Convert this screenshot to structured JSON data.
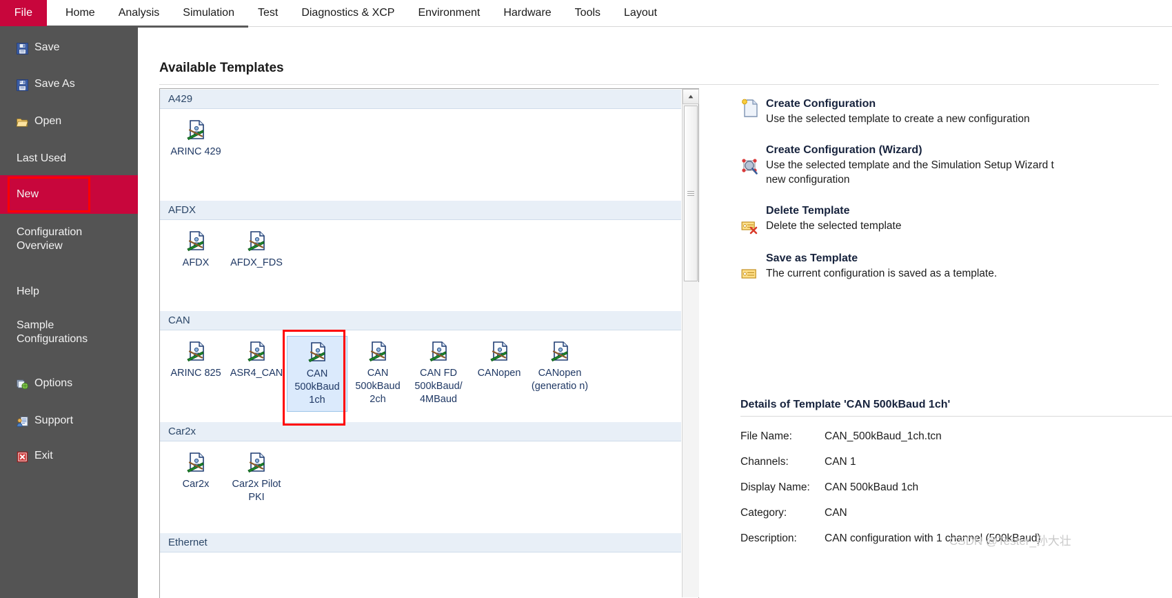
{
  "ribbon": {
    "file_label": "File",
    "tabs": [
      {
        "label": "Home"
      },
      {
        "label": "Analysis"
      },
      {
        "label": "Simulation"
      },
      {
        "label": "Test"
      },
      {
        "label": "Diagnostics & XCP"
      },
      {
        "label": "Environment"
      },
      {
        "label": "Hardware"
      },
      {
        "label": "Tools"
      },
      {
        "label": "Layout"
      }
    ]
  },
  "colors": {
    "accent": "#c8063c",
    "sidebar_bg": "#545454",
    "selection_outline": "#ff0000",
    "tile_selected_bg": "#dbeafc",
    "group_header_bg": "#e8eff7"
  },
  "sidebar": {
    "items": [
      {
        "label": "Save",
        "icon": "save-icon",
        "selected": false
      },
      {
        "label": "Save As",
        "icon": "save-as-icon",
        "selected": false
      },
      {
        "label": "Open",
        "icon": "open-folder-icon",
        "selected": false
      },
      {
        "label": "Last Used",
        "icon": "",
        "selected": false
      },
      {
        "label": "New",
        "icon": "",
        "selected": true
      },
      {
        "label": "Configuration\nOverview",
        "icon": "",
        "selected": false
      },
      {
        "label": "Help",
        "icon": "",
        "selected": false
      },
      {
        "label": "Sample\nConfigurations",
        "icon": "",
        "selected": false
      },
      {
        "label": "Options",
        "icon": "options-icon",
        "selected": false
      },
      {
        "label": "Support",
        "icon": "support-icon",
        "selected": false
      },
      {
        "label": "Exit",
        "icon": "exit-icon",
        "selected": false
      }
    ]
  },
  "templates": {
    "heading": "Available Templates",
    "groups": [
      {
        "name": "A429",
        "items": [
          {
            "label": "ARINC\n429",
            "selected": false
          }
        ]
      },
      {
        "name": "AFDX",
        "items": [
          {
            "label": "AFDX",
            "selected": false
          },
          {
            "label": "AFDX_FDS",
            "selected": false
          }
        ]
      },
      {
        "name": "CAN",
        "items": [
          {
            "label": "ARINC\n825",
            "selected": false
          },
          {
            "label": "ASR4_CAN",
            "selected": false
          },
          {
            "label": "CAN\n500kBaud\n1ch",
            "selected": true
          },
          {
            "label": "CAN\n500kBaud\n2ch",
            "selected": false
          },
          {
            "label": "CAN FD\n500kBaud/\n4MBaud",
            "selected": false
          },
          {
            "label": "CANopen",
            "selected": false
          },
          {
            "label": "CANopen\n(generatio\nn)",
            "selected": false
          }
        ]
      },
      {
        "name": "Car2x",
        "items": [
          {
            "label": "Car2x",
            "selected": false
          },
          {
            "label": "Car2x Pilot\nPKI",
            "selected": false
          }
        ]
      },
      {
        "name": "Ethernet",
        "items": []
      }
    ]
  },
  "actions": [
    {
      "icon": "new-document-icon",
      "title": "Create Configuration",
      "description": "Use the selected template to create a new configuration"
    },
    {
      "icon": "wizard-magnifier-icon",
      "title": "Create Configuration (Wizard)",
      "description": "Use the selected template and the Simulation Setup Wizard t\nnew configuration"
    },
    {
      "icon": "delete-template-icon",
      "title": "Delete Template",
      "description": "Delete the selected template"
    },
    {
      "icon": "save-template-icon",
      "title": "Save as Template",
      "description": "The current configuration is saved as a template."
    }
  ],
  "details": {
    "title": "Details of Template 'CAN 500kBaud 1ch'",
    "rows": [
      {
        "key": "File Name:",
        "value": "CAN_500kBaud_1ch.tcn"
      },
      {
        "key": "Channels:",
        "value": "CAN 1"
      },
      {
        "key": "Display Name:",
        "value": "CAN 500kBaud 1ch"
      },
      {
        "key": "Category:",
        "value": "CAN"
      },
      {
        "key": "Description:",
        "value": "CAN configuration with 1 channel (500kBaud)"
      }
    ]
  },
  "watermark": {
    "text": "CSDN @Tester_孙大壮"
  }
}
